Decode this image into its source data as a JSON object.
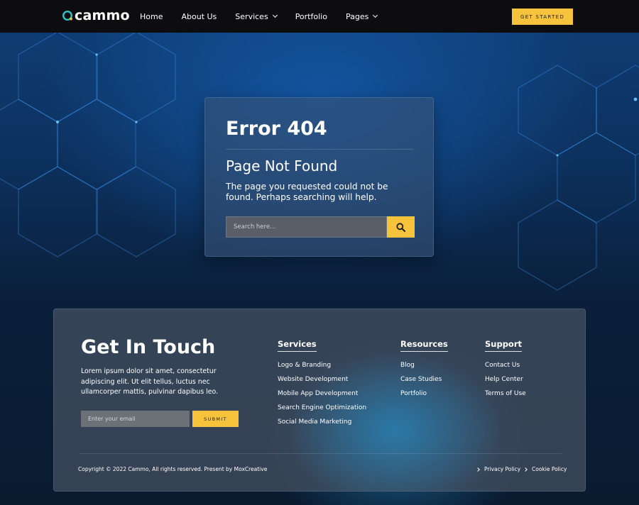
{
  "brand": {
    "name": "cammo",
    "accent_color": "#f7c33c",
    "logo_icon": "c-ring-icon"
  },
  "nav": {
    "items": [
      {
        "label": "Home",
        "dropdown": false
      },
      {
        "label": "About Us",
        "dropdown": false
      },
      {
        "label": "Services",
        "dropdown": true
      },
      {
        "label": "Portfolio",
        "dropdown": false
      },
      {
        "label": "Pages",
        "dropdown": true
      }
    ],
    "cta_label": "GET STARTED"
  },
  "error": {
    "code": "Error 404",
    "title": "Page Not Found",
    "message": "The page you requested could not be found. Perhaps searching will help.",
    "search_placeholder": "Search here...",
    "search_icon": "search-icon"
  },
  "footer": {
    "heading": "Get In Touch",
    "text": "Lorem ipsum dolor sit amet, consectetur adipiscing elit. Ut elit tellus, luctus nec ullamcorper mattis, pulvinar dapibus leo.",
    "email_placeholder": "Enter your email",
    "submit_label": "SUBMIT",
    "columns": [
      {
        "title": "Services",
        "links": [
          "Logo & Branding",
          "Website Development",
          "Mobile App Development",
          "Search Engine Optimization",
          "Social Media Marketing"
        ]
      },
      {
        "title": "Resources",
        "links": [
          "Blog",
          "Case Studies",
          "Portfolio"
        ]
      },
      {
        "title": "Support",
        "links": [
          "Contact Us",
          "Help Center",
          "Terms of Use"
        ]
      }
    ],
    "copyright": "Copyright © 2022 Cammo, All rights reserved. Present by MoxCreative",
    "legal_links": [
      "Privacy Policy",
      "Cookie Policy"
    ]
  }
}
